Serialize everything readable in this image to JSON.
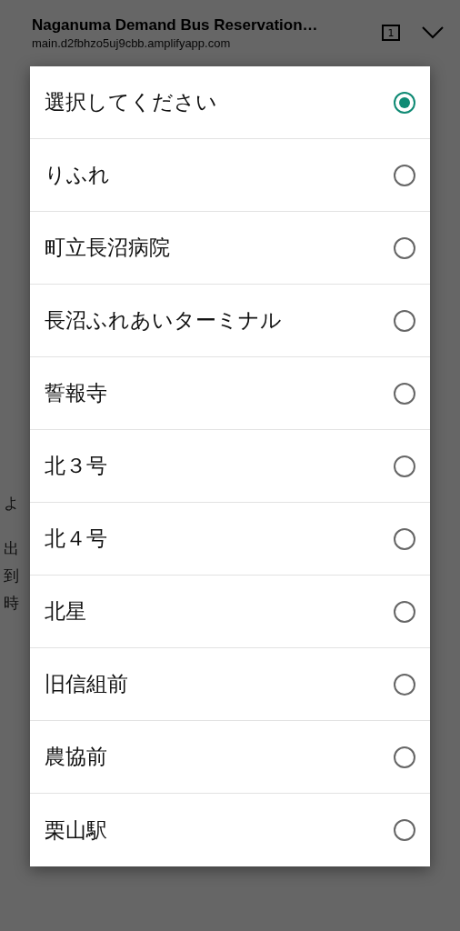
{
  "browser_bar": {
    "title": "Naganuma Demand Bus Reservation…",
    "url": "main.d2fbhzo5uj9cbb.amplifyapp.com",
    "tab_count": "1"
  },
  "page": {
    "lines": [
      "よ",
      "出",
      "到",
      "時"
    ]
  },
  "picker": {
    "options": [
      {
        "label": "選択してください",
        "selected": true
      },
      {
        "label": "りふれ",
        "selected": false
      },
      {
        "label": "町立長沼病院",
        "selected": false
      },
      {
        "label": "長沼ふれあいターミナル",
        "selected": false
      },
      {
        "label": "誓報寺",
        "selected": false
      },
      {
        "label": "北３号",
        "selected": false
      },
      {
        "label": "北４号",
        "selected": false
      },
      {
        "label": "北星",
        "selected": false
      },
      {
        "label": "旧信組前",
        "selected": false
      },
      {
        "label": "農協前",
        "selected": false
      },
      {
        "label": "栗山駅",
        "selected": false
      }
    ]
  }
}
